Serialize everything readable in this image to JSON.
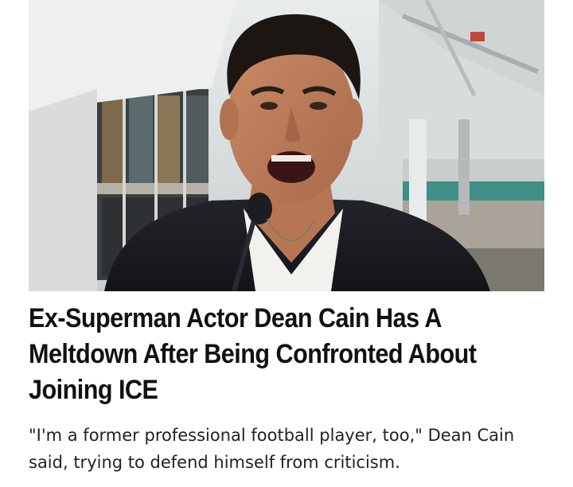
{
  "article": {
    "headline": "Ex-Superman Actor Dean Cain Has A Meltdown After Being Confronted About Joining ICE",
    "dek": "\"I'm a former professional football player, too,\" Dean Cain said, trying to defend himself from criticism."
  },
  "colors": {
    "headline_text": "#111111",
    "dek_text": "#222222",
    "background": "#ffffff"
  }
}
